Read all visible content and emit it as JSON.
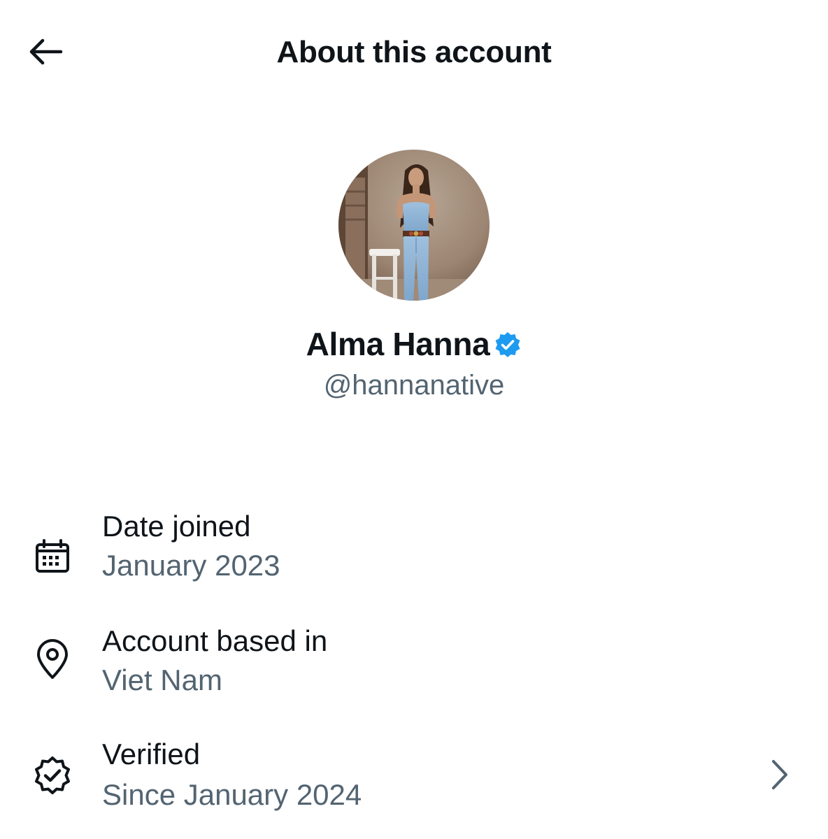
{
  "header": {
    "title": "About this account",
    "back_icon": "arrow-left-icon"
  },
  "profile": {
    "display_name": "Alma Hanna",
    "handle": "@hannanative",
    "verified_badge_color": "#1d9bf0",
    "avatar": "profile-photo"
  },
  "info": [
    {
      "icon": "calendar-icon",
      "label": "Date joined",
      "value": "January 2023"
    },
    {
      "icon": "location-pin-icon",
      "label": "Account based in",
      "value": "Viet Nam"
    },
    {
      "icon": "verified-check-icon",
      "label": "Verified",
      "value": "Since January 2024",
      "chevron": "chevron-right-icon"
    }
  ],
  "colors": {
    "primary_text": "#0f1419",
    "secondary_text": "#536471",
    "accent": "#1d9bf0",
    "background": "#ffffff"
  }
}
